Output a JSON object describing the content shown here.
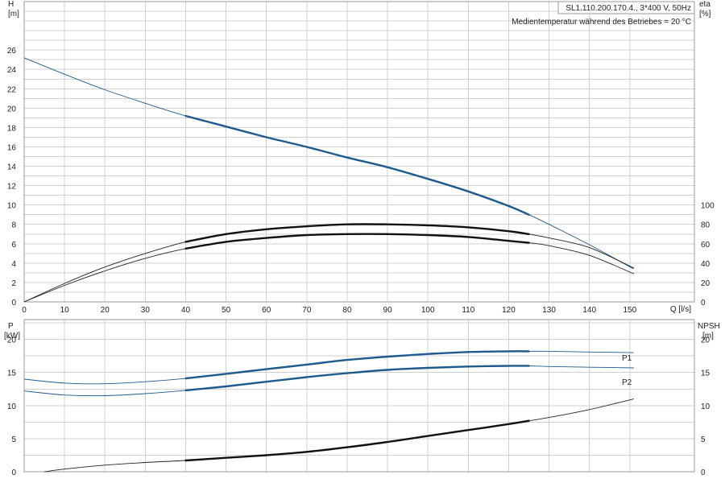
{
  "header": {
    "model": "SL1.110.200.170.4., 3*400 V, 50Hz",
    "medium": "Medientemperatur während des Betriebes = 20 °C"
  },
  "colors": {
    "blue": "#1f5a8c",
    "black": "#111111",
    "thin": "#555555"
  },
  "chart_data": [
    {
      "type": "line",
      "panel": "top",
      "xlabel": "Q [l/s]",
      "x_ticks": [
        0,
        10,
        20,
        30,
        40,
        50,
        60,
        70,
        80,
        90,
        100,
        110,
        120,
        130,
        140,
        150
      ],
      "xlim": [
        0,
        166
      ],
      "left_axis": {
        "label_top": "H",
        "label_unit": "[m]",
        "ylim": [
          0,
          31
        ],
        "ticks": [
          0,
          2,
          4,
          6,
          8,
          10,
          12,
          14,
          16,
          18,
          20,
          22,
          24,
          26
        ]
      },
      "right_axis": {
        "label_top": "eta",
        "label_unit": "[%]",
        "ylim": [
          0,
          100
        ],
        "ticks": [
          0,
          20,
          40,
          60,
          80,
          100
        ],
        "offset_m": 0,
        "per_m": 10
      },
      "series": [
        {
          "key": "H",
          "color_key": "blue",
          "bold_range": [
            40,
            125
          ],
          "x": [
            0,
            10,
            20,
            30,
            40,
            50,
            60,
            70,
            80,
            90,
            100,
            110,
            120,
            125,
            130,
            140,
            151
          ],
          "y": [
            25.2,
            23.5,
            21.9,
            20.5,
            19.2,
            18.1,
            17.0,
            16.0,
            14.9,
            13.9,
            12.7,
            11.4,
            9.9,
            9.0,
            8.0,
            5.9,
            3.4
          ]
        },
        {
          "key": "eta1",
          "axis": "right",
          "color_key": "black",
          "bold_range": [
            40,
            125
          ],
          "x": [
            0,
            10,
            20,
            30,
            40,
            50,
            60,
            70,
            80,
            90,
            100,
            110,
            120,
            125,
            130,
            140,
            151
          ],
          "y": [
            0,
            19,
            36,
            50,
            62,
            70,
            75,
            78,
            80,
            80,
            79,
            77,
            73,
            70,
            66,
            56,
            35
          ]
        },
        {
          "key": "eta2",
          "axis": "right",
          "color_key": "black",
          "bold_range": [
            40,
            125
          ],
          "x": [
            0,
            10,
            20,
            30,
            40,
            50,
            60,
            70,
            80,
            90,
            100,
            110,
            120,
            125,
            130,
            140,
            151
          ],
          "y": [
            0,
            17,
            32,
            45,
            55,
            62,
            66,
            69,
            70,
            70,
            69,
            67,
            63,
            61,
            58,
            48,
            29
          ]
        }
      ]
    },
    {
      "type": "line",
      "panel": "bottom",
      "xlim": [
        0,
        166
      ],
      "left_axis": {
        "label_top": "P",
        "label_unit": "[kW]",
        "ylim": [
          0,
          23
        ],
        "ticks": [
          0,
          5,
          10,
          15,
          20
        ]
      },
      "right_axis": {
        "label_top": "NPSH",
        "label_unit": "[m]",
        "ylim": [
          0,
          23
        ],
        "ticks": [
          0,
          5,
          10,
          15,
          20
        ]
      },
      "series": [
        {
          "name": "P1",
          "color_key": "blue",
          "bold_range": [
            40,
            125
          ],
          "x": [
            0,
            10,
            20,
            30,
            40,
            50,
            60,
            70,
            80,
            90,
            100,
            110,
            120,
            125,
            130,
            140,
            151
          ],
          "y": [
            14.0,
            13.4,
            13.3,
            13.6,
            14.1,
            14.8,
            15.5,
            16.2,
            16.9,
            17.4,
            17.8,
            18.1,
            18.2,
            18.2,
            18.2,
            18.1,
            18.0
          ]
        },
        {
          "name": "P2",
          "color_key": "blue",
          "bold_range": [
            40,
            125
          ],
          "x": [
            0,
            10,
            20,
            30,
            40,
            50,
            60,
            70,
            80,
            90,
            100,
            110,
            120,
            125,
            130,
            140,
            151
          ],
          "y": [
            12.2,
            11.6,
            11.5,
            11.8,
            12.3,
            12.9,
            13.6,
            14.3,
            14.9,
            15.4,
            15.7,
            15.9,
            16.0,
            16.0,
            15.9,
            15.8,
            15.7
          ]
        },
        {
          "key": "NPSH",
          "axis": "right",
          "color_key": "black",
          "bold_range": [
            40,
            125
          ],
          "x": [
            5,
            10,
            20,
            30,
            40,
            50,
            60,
            70,
            80,
            90,
            100,
            110,
            120,
            125,
            130,
            140,
            151
          ],
          "y": [
            0,
            0.4,
            1.0,
            1.4,
            1.7,
            2.1,
            2.5,
            3.0,
            3.7,
            4.5,
            5.4,
            6.3,
            7.2,
            7.7,
            8.2,
            9.4,
            11.0
          ]
        }
      ]
    }
  ]
}
